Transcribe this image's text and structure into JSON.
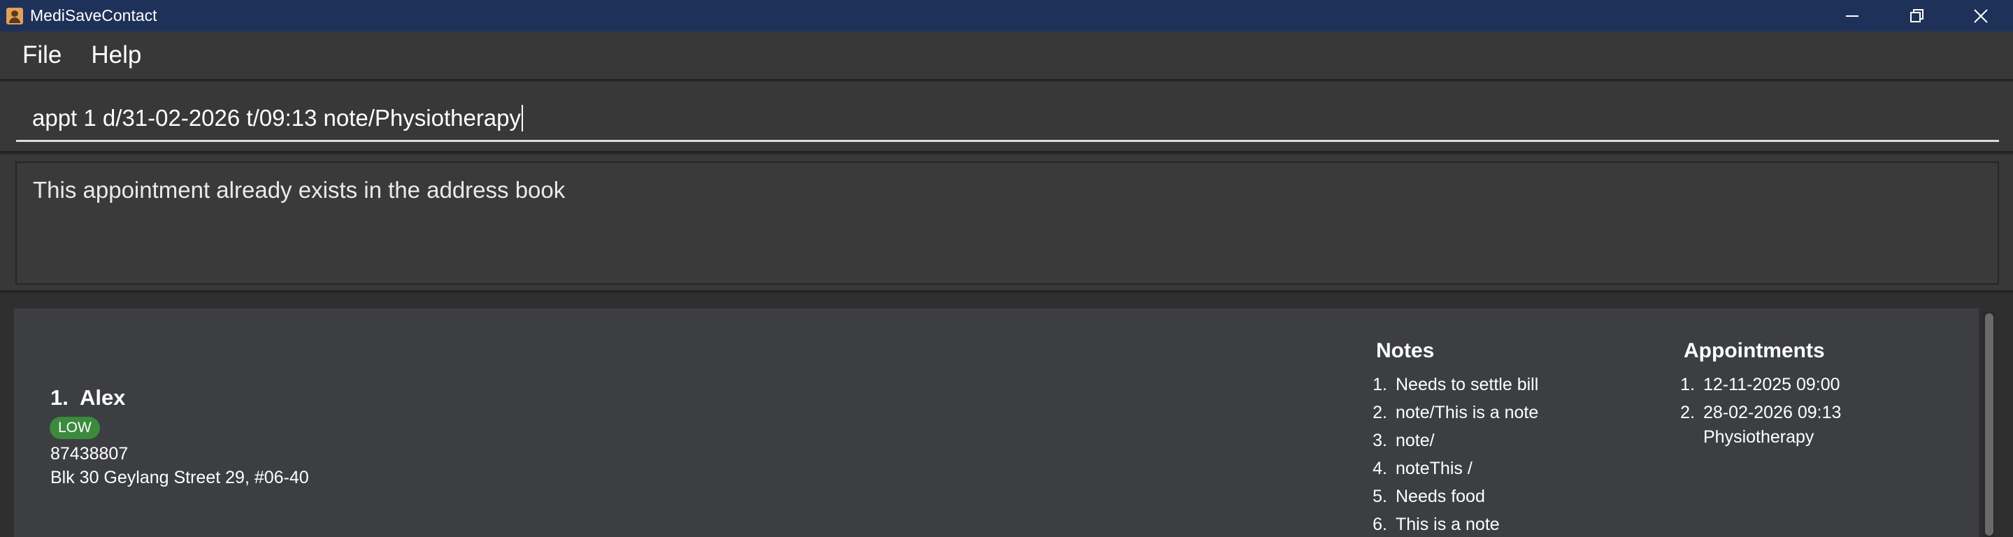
{
  "window": {
    "title": "MediSaveContact"
  },
  "menu": {
    "items": [
      "File",
      "Help"
    ]
  },
  "command": {
    "value": "appt 1 d/31-02-2026 t/09:13 note/Physiotherapy"
  },
  "result": {
    "text": "This appointment already exists in the address book"
  },
  "person": {
    "index": "1.",
    "name": "Alex",
    "priority": "LOW",
    "phone": "87438807",
    "address": "Blk 30 Geylang Street 29, #06-40",
    "notes_heading": "Notes",
    "notes": [
      {
        "num": "1.",
        "text": "Needs to settle bill"
      },
      {
        "num": "2.",
        "text": "note/This is a note"
      },
      {
        "num": "3.",
        "text": "note/"
      },
      {
        "num": "4.",
        "text": "noteThis /"
      },
      {
        "num": "5.",
        "text": "Needs food"
      },
      {
        "num": "6.",
        "text": "This is a note"
      }
    ],
    "appointments_heading": "Appointments",
    "appointments": [
      {
        "num": "1.",
        "datetime": "12-11-2025 09:00",
        "note": ""
      },
      {
        "num": "2.",
        "datetime": "28-02-2026 09:13",
        "note": "Physiotherapy"
      }
    ]
  },
  "colors": {
    "titlebar": "#1e3158",
    "badge_low": "#3b8a3e",
    "card": "#3c3e41"
  }
}
